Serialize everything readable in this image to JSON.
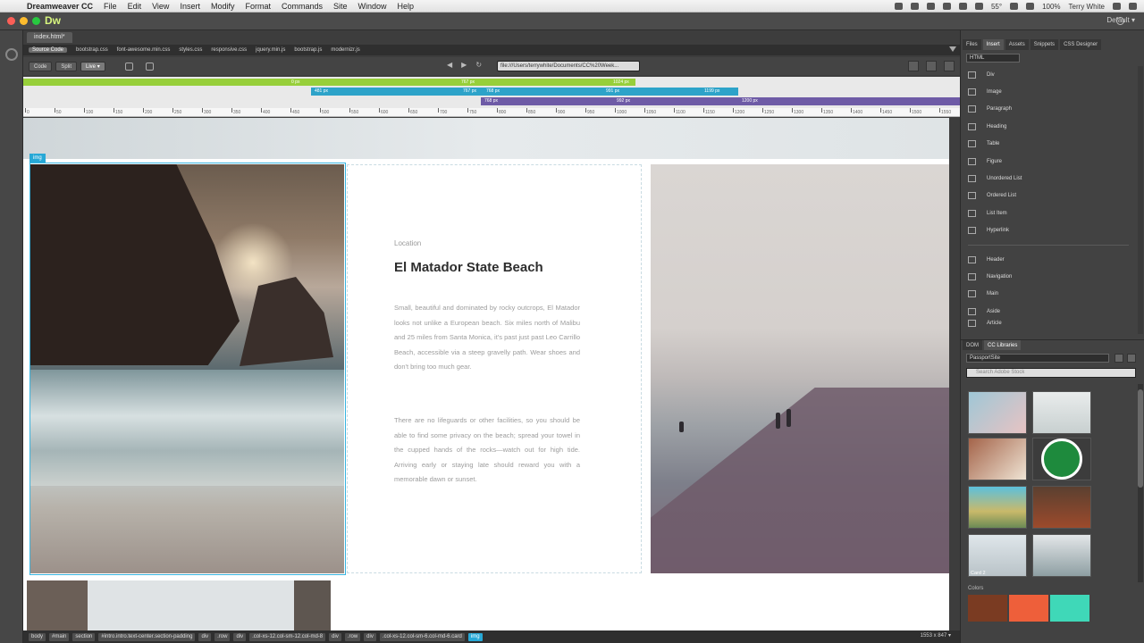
{
  "menubar": {
    "apple": "",
    "app_name": "Dreamweaver CC",
    "items": [
      "File",
      "Edit",
      "View",
      "Insert",
      "Modify",
      "Format",
      "Commands",
      "Site",
      "Window",
      "Help"
    ],
    "status": {
      "temp": "55°",
      "battery": "100%",
      "user": "Terry White"
    }
  },
  "titlebar": {
    "logo": "Dw",
    "workspace": "Default ▾"
  },
  "document": {
    "tab": "index.html*",
    "source_label": "Source Code",
    "files": [
      "bootstrap.css",
      "font-awesome.min.css",
      "styles.css",
      "responsive.css",
      "jquery.min.js",
      "bootstrap.js",
      "modernizr.js"
    ],
    "view_buttons": {
      "code": "Code",
      "split": "Split",
      "live": "Live ▾"
    },
    "url": "file:///Users/terrywhite/Documents/CC%20Week..."
  },
  "media_queries": {
    "green": [
      "0 px",
      "767 px",
      "1024 px"
    ],
    "blue": [
      "481 px",
      "767 px",
      "768 px",
      "991 px",
      "1199 px"
    ],
    "purple": [
      "768 px",
      "992 px",
      "1200 px"
    ]
  },
  "ruler": [
    "0",
    "50",
    "100",
    "150",
    "200",
    "250",
    "300",
    "350",
    "400",
    "450",
    "500",
    "550",
    "600",
    "650",
    "700",
    "750",
    "800",
    "850",
    "900",
    "950",
    "1000",
    "1050",
    "1100",
    "1150",
    "1200",
    "1250",
    "1300",
    "1350",
    "1400",
    "1450",
    "1500",
    "1550"
  ],
  "live": {
    "selection_badge": "img",
    "location_label": "Location",
    "title": "El Matador State Beach",
    "paragraph1": "Small, beautiful and dominated by rocky outcrops, El Matador looks not unlike a European beach. Six miles north of Malibu and 25 miles from Santa Monica, it's past just past Leo Carrillo Beach, accessible via a steep gravelly path. Wear shoes and don't bring too much gear.",
    "paragraph2": "There are no lifeguards or other facilities, so you should be able to find some privacy on the beach; spread your towel in the cupped hands of the rocks—watch out for high tide. Arriving early or staying late should reward you with a memorable dawn or sunset."
  },
  "statusbar": {
    "crumbs": [
      "body",
      "#main",
      "section",
      "#intro.intro.text-center.section-padding",
      "div",
      ".row",
      "div",
      ".col-xs-12.col-sm-12.col-md-8",
      "div",
      ".row",
      "div",
      ".col-xs-12.col-sm-6.col-md-6.card",
      "img"
    ],
    "dimensions": "1553 x 847 ▾"
  },
  "panel": {
    "tabs": [
      "Files",
      "Insert",
      "Assets",
      "Snippets",
      "CSS Designer"
    ],
    "active_tab": "Insert",
    "category": "HTML",
    "insert_items": [
      "Div",
      "Image",
      "Paragraph",
      "Heading",
      "Table",
      "Figure",
      "Unordered List",
      "Ordered List",
      "List Item",
      "Hyperlink"
    ],
    "insert_items_2": [
      "Header",
      "Navigation",
      "Main",
      "Aside",
      "Article"
    ]
  },
  "libraries": {
    "tabs": [
      "DOM",
      "CC Libraries"
    ],
    "library_name": "PassportSite",
    "search_placeholder": "Search Adobe Stock",
    "card_caption": "Card 2",
    "colors_label": "Colors",
    "colors": [
      "#7a3b22",
      "#ee5f3a",
      "#3fd8b8"
    ]
  }
}
